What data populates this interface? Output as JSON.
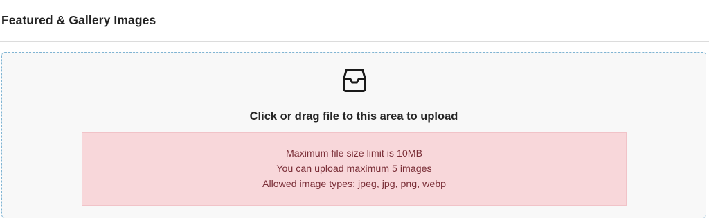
{
  "section": {
    "title": "Featured & Gallery Images"
  },
  "upload": {
    "icon": "inbox-icon",
    "prompt": "Click or drag file to this area to upload",
    "limits": [
      "Maximum file size limit is 10MB",
      "You can upload maximum 5 images",
      "Allowed image types: jpeg, jpg, png, webp"
    ]
  },
  "colors": {
    "dropzone_border": "#7fb4d3",
    "dropzone_background": "#f8f8f8",
    "alert_background": "#f8d7da",
    "alert_text": "#7a2e37"
  }
}
